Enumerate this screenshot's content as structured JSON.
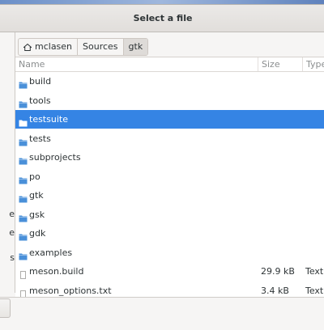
{
  "dialog": {
    "title": "Select a file"
  },
  "sidebar": {
    "partial_labels": [
      "e",
      "e",
      "s"
    ]
  },
  "pathbar": {
    "crumbs": [
      {
        "label": "mclasen",
        "icon": "home-icon"
      },
      {
        "label": "Sources"
      },
      {
        "label": "gtk",
        "active": true
      }
    ]
  },
  "columns": {
    "name": "Name",
    "size": "Size",
    "type": "Type"
  },
  "files": [
    {
      "name": "build",
      "icon": "folder-icon",
      "size": "",
      "type": ""
    },
    {
      "name": "tools",
      "icon": "folder-icon",
      "size": "",
      "type": ""
    },
    {
      "name": "testsuite",
      "icon": "folder-icon",
      "size": "",
      "type": "",
      "selected": true
    },
    {
      "name": "tests",
      "icon": "folder-icon",
      "size": "",
      "type": ""
    },
    {
      "name": "subprojects",
      "icon": "folder-icon",
      "size": "",
      "type": ""
    },
    {
      "name": "po",
      "icon": "folder-icon",
      "size": "",
      "type": ""
    },
    {
      "name": "gtk",
      "icon": "folder-icon",
      "size": "",
      "type": ""
    },
    {
      "name": "gsk",
      "icon": "folder-icon",
      "size": "",
      "type": ""
    },
    {
      "name": "gdk",
      "icon": "folder-icon",
      "size": "",
      "type": ""
    },
    {
      "name": "examples",
      "icon": "folder-icon",
      "size": "",
      "type": ""
    },
    {
      "name": "meson.build",
      "icon": "file-icon",
      "size": "29.9 kB",
      "type": "Text"
    },
    {
      "name": "meson_options.txt",
      "icon": "file-icon",
      "size": "3.4 kB",
      "type": "Text"
    }
  ],
  "colors": {
    "accent": "#3584e4",
    "folder": "#4a90d9"
  }
}
